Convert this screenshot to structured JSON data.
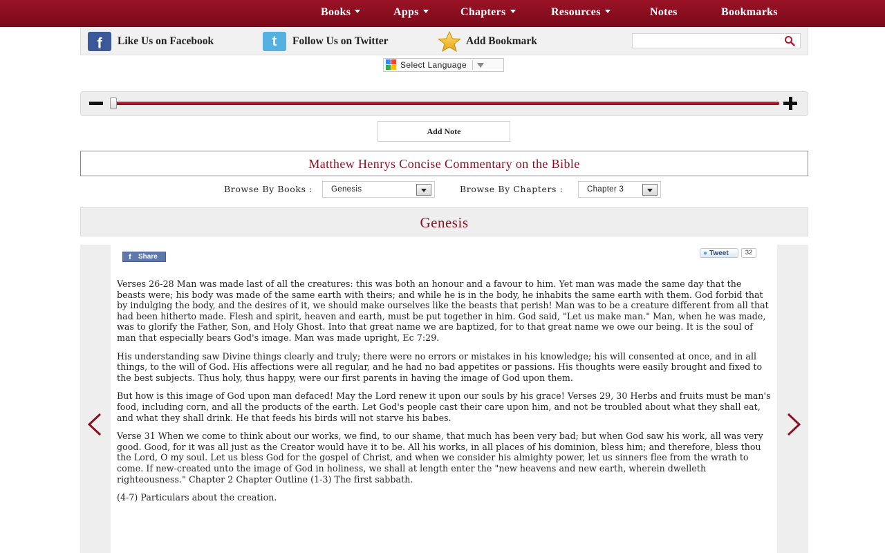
{
  "nav": {
    "items": [
      {
        "label": "Books",
        "dropdown": true
      },
      {
        "label": "Apps",
        "dropdown": true
      },
      {
        "label": "Chapters",
        "dropdown": true
      },
      {
        "label": "Resources",
        "dropdown": true
      },
      {
        "label": "Notes",
        "dropdown": false
      },
      {
        "label": "Bookmarks",
        "dropdown": false
      }
    ]
  },
  "social": {
    "facebook": "Like Us on Facebook",
    "twitter": "Follow Us on Twitter",
    "bookmark": "Add Bookmark",
    "search_value": ""
  },
  "language": {
    "label": "Select Language"
  },
  "slider": {
    "value_fraction": 0.0
  },
  "add_note": "Add Note",
  "title": "Matthew Henrys Concise Commentary on the Bible",
  "browse": {
    "books_label": "Browse By Books :",
    "books_value": "Genesis",
    "chapters_label": "Browse By Chapters :",
    "chapters_value": "Chapter 3"
  },
  "book_heading": "Genesis",
  "share": {
    "label": "Share",
    "tweet_label": "Tweet",
    "tweet_count": "32"
  },
  "paragraphs": [
    "Verses 26-28 Man was made last of all the creatures: this was both an honour and a favour to him. Yet man was made the same day that the beasts were; his body was made of the same earth with theirs; and while he is in the body, he inhabits the same earth with them. God forbid that by indulging the body, and the desires of it, we should make ourselves like the beasts that perish! Man was to be a creature different from all that had been hitherto made. Flesh and spirit, heaven and earth, must be put together in him. God said, \"Let us make man.\" Man, when he was made, was to glorify the Father, Son, and Holy Ghost. Into that great name we are baptized, for to that great name we owe our being. It is the soul of man that especially bears God's image. Man was made upright, Ec 7:29.",
    "His understanding saw Divine things clearly and truly; there were no errors or mistakes in his knowledge; his will consented at once, and in all things, to the will of God. His affections were all regular, and he had no bad appetites or passions. His thoughts were easily brought and fixed to the best subjects. Thus holy, thus happy, were our first parents in having the image of God upon them.",
    "But how is this image of God upon man defaced! May the Lord renew it upon our souls by his grace! Verses 29, 30 Herbs and fruits must be man's food, including corn, and all the products of the earth. Let God's people cast their care upon him, and not be troubled about what they shall eat, and what they shall drink. He that feeds his birds will not starve his babes.",
    "Verse 31 When we come to think about our works, we find, to our shame, that much has been very bad; but when God saw his work, all was very good. Good, for it was all just as the Creator would have it to be. All his works, in all places of his dominion, bless him; and therefore, bless thou the Lord, O my soul. Let us bless God for the gospel of Christ, and when we consider his almighty power, let us sinners flee from the wrath to come. If new-created unto the image of God in holiness, we shall at length enter the \"new heavens and new earth, wherein dwelleth righteousness.\" Chapter 2 Chapter Outline (1-3) The first sabbath.",
    "(4-7) Particulars about the creation."
  ],
  "colors": {
    "brand": "#8a1020",
    "nav_bg": "#8c0e20"
  }
}
